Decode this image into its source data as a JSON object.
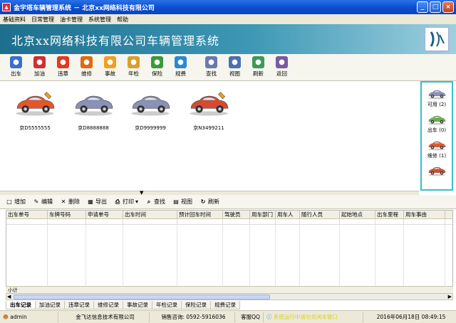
{
  "window": {
    "title": "金宇塔车辆管理系统 － 北京xx网络科技有限公司",
    "minimize": "_",
    "maximize": "□",
    "close": "×"
  },
  "menu": [
    "基础资料",
    "日常管理",
    "油卡管理",
    "系统管理",
    "帮助"
  ],
  "banner": {
    "title": "北京xx网络科技有限公司车辆管理系统"
  },
  "toolbar": [
    {
      "label": "出车",
      "icon": "car-out-icon",
      "color": "#3a6fd0"
    },
    {
      "label": "加油",
      "icon": "fuel-icon",
      "color": "#d03030"
    },
    {
      "label": "违章",
      "icon": "no-entry-icon",
      "color": "#e03a20"
    },
    {
      "label": "维修",
      "icon": "repair-icon",
      "color": "#e06a10"
    },
    {
      "label": "事故",
      "icon": "accident-icon",
      "color": "#f0a020"
    },
    {
      "label": "年检",
      "icon": "inspection-icon",
      "color": "#d8a030"
    },
    {
      "label": "保险",
      "icon": "insurance-icon",
      "color": "#3a9a3a"
    },
    {
      "label": "规费",
      "icon": "fees-icon",
      "color": "#2a8ad0"
    },
    {
      "label": "查找",
      "icon": "search-icon",
      "color": "#6a7ab0"
    },
    {
      "label": "视图",
      "icon": "view-icon",
      "color": "#4a70b0"
    },
    {
      "label": "刷新",
      "icon": "refresh-icon",
      "color": "#3a9a5a"
    },
    {
      "label": "返回",
      "icon": "return-icon",
      "color": "#7a5aa0"
    }
  ],
  "cars": [
    {
      "plate": "京D5555555",
      "body": "#e8542a",
      "status": "repair"
    },
    {
      "plate": "京D8888888",
      "body": "#8a92b8",
      "status": "available"
    },
    {
      "plate": "京D9999999",
      "body": "#8a92b8",
      "status": "available"
    },
    {
      "plate": "京N3499211",
      "body": "#d84a30",
      "status": "repair"
    }
  ],
  "status_panel": [
    {
      "label": "可用 (2)",
      "body": "#8a92b8"
    },
    {
      "label": "出车 (0)",
      "body": "#6ab04a"
    },
    {
      "label": "维修 (1)",
      "body": "#e8542a"
    },
    {
      "label": "",
      "body": "#d84a30"
    }
  ],
  "subtoolbar": [
    {
      "label": "增加",
      "icon": "add-icon",
      "glyph": "□"
    },
    {
      "label": "编辑",
      "icon": "edit-icon",
      "glyph": "✎"
    },
    {
      "label": "删除",
      "icon": "delete-icon",
      "glyph": "✕"
    },
    {
      "label": "导出",
      "icon": "export-icon",
      "glyph": "▦"
    },
    {
      "label": "打印",
      "icon": "print-icon",
      "glyph": "⎙"
    },
    {
      "label": "查找",
      "icon": "search-icon",
      "glyph": "⌕"
    },
    {
      "label": "视图",
      "icon": "view-icon",
      "glyph": "▤"
    },
    {
      "label": "刷新",
      "icon": "refresh-icon",
      "glyph": "↻"
    }
  ],
  "grid": {
    "columns": [
      "出车单号",
      "车牌号码",
      "申请单号",
      "出车时间",
      "预计回车时间",
      "驾驶员",
      "用车部门",
      "用车人",
      "随行人员",
      "起始地点",
      "出车里程",
      "用车事由"
    ],
    "subtotal_label": "小计"
  },
  "tabs": [
    "出车记录",
    "加油记录",
    "违章记录",
    "维修记录",
    "事故记录",
    "年检记录",
    "保险记录",
    "规费记录"
  ],
  "status": {
    "user": "admin",
    "company": "金飞达信息技术有限公司",
    "sales": "销售咨询: 0592-5916036",
    "service": "客服QQ",
    "notice": "系统运行中请勿关闭本窗口",
    "datetime": "2016年06月18日 08:49:15"
  }
}
